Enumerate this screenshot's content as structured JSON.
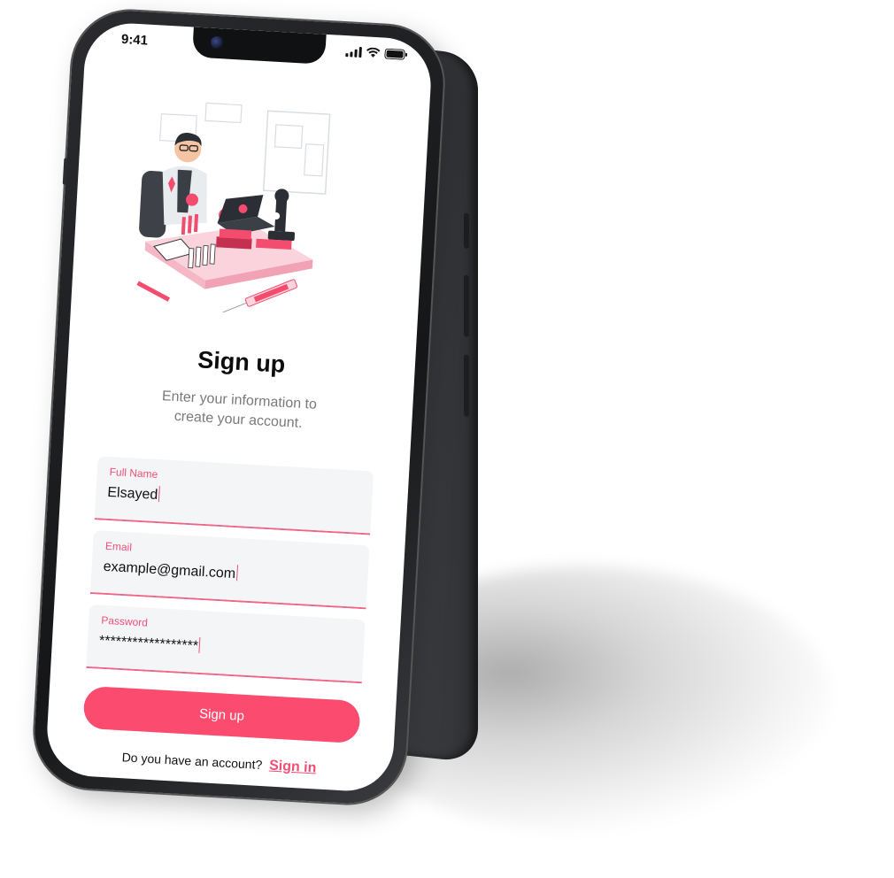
{
  "status_bar": {
    "time": "9:41",
    "icons": [
      "signal-icon",
      "wifi-icon",
      "battery-icon"
    ]
  },
  "illustration": {
    "icon": "lab-scientist-illustration",
    "accent_color": "#f8b7c6",
    "primary_color": "#f34c6e"
  },
  "screen": {
    "title": "Sign up",
    "subtitle_line1": "Enter your information to",
    "subtitle_line2": "create your account."
  },
  "form": {
    "full_name": {
      "label": "Full Name",
      "value": "Elsayed"
    },
    "email": {
      "label": "Email",
      "value": "example@gmail.com"
    },
    "password": {
      "label": "Password",
      "value": "******************"
    }
  },
  "actions": {
    "signup_label": "Sign up",
    "footer_text": "Do you have an account?",
    "signin_label": "Sign in"
  },
  "colors": {
    "accent": "#fb4b6e",
    "label": "#ef4f77",
    "field_bg": "#f4f5f7"
  }
}
